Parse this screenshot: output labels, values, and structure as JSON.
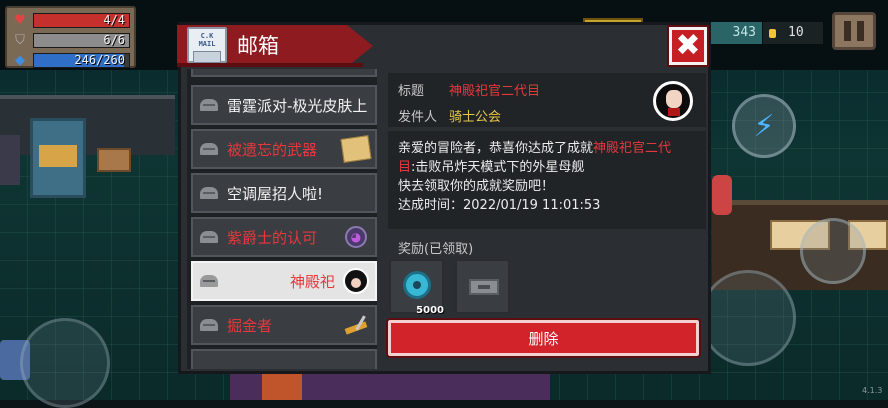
{
  "hud": {
    "hp": "4/4",
    "hp_fraction": 1.0,
    "armor": "6/6",
    "armor_fraction": 1.0,
    "energy": "246/260",
    "energy_fraction": 0.946,
    "gems": "343",
    "coins": "10",
    "version": "4.1.3"
  },
  "mailbox": {
    "title": "邮箱",
    "logo_text": "C.K\nMAIL",
    "close_icon": "✖",
    "list": [
      {
        "label": "雷霆派对-极光皮肤上",
        "color": "normal",
        "thumb": "none"
      },
      {
        "label": "被遗忘的武器",
        "color": "red",
        "thumb": "scroll"
      },
      {
        "label": "空调屋招人啦!",
        "color": "normal",
        "thumb": "none"
      },
      {
        "label": "紫爵士的认可",
        "color": "red",
        "thumb": "mask"
      },
      {
        "label": "神殿祀",
        "color": "red",
        "thumb": "avatar",
        "selected": true
      },
      {
        "label": "掘金者",
        "color": "red",
        "thumb": "shovel"
      }
    ],
    "detail": {
      "subject_label": "标题",
      "subject": "神殿祀官二代目",
      "sender_label": "发件人",
      "sender": "骑士公会",
      "body_1": "亲爱的冒险者，恭喜你达成了成就",
      "body_1_hl": "神殿祀官二代",
      "body_2_hl": "目",
      "body_2": ":击败吊炸天模式下的外星母舰",
      "body_3": "快去领取你的成就奖励吧！",
      "body_4": "达成时间：2022/01/19 11:01:53",
      "reward_label": "奖励(已领取)",
      "reward_gems": "5000",
      "delete_label": "删除"
    }
  },
  "colors": {
    "accent_red": "#d2232a",
    "highlight_red": "#e6383c",
    "sender_gold": "#e8c84a",
    "panel": "#2b2e33"
  }
}
